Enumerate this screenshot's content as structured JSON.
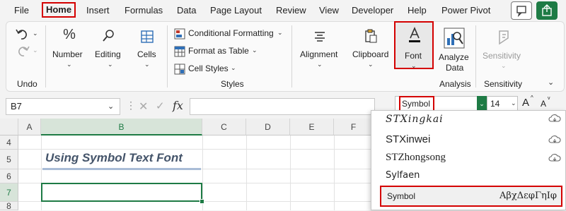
{
  "menu": {
    "tabs": [
      "File",
      "Home",
      "Insert",
      "Formulas",
      "Data",
      "Page Layout",
      "Review",
      "View",
      "Developer",
      "Help",
      "Power Pivot"
    ],
    "active": "Home"
  },
  "ribbon": {
    "undo_label": "Undo",
    "number_label": "Number",
    "editing_label": "Editing",
    "cells_label": "Cells",
    "cond_format": "Conditional Formatting",
    "format_table": "Format as Table",
    "cell_styles": "Cell Styles",
    "styles_label": "Styles",
    "alignment_label": "Alignment",
    "clipboard_label": "Clipboard",
    "font_label": "Font",
    "analyze_label_1": "Analyze",
    "analyze_label_2": "Data",
    "analysis_label": "Analysis",
    "sensitivity_btn": "Sensitivity",
    "sensitivity_label": "Sensitivity"
  },
  "formula_bar": {
    "name_box": "B7",
    "fx": "fx",
    "font_name": "Symbol",
    "font_size": "14",
    "grow_glyph": "A",
    "shrink_glyph": "A"
  },
  "grid": {
    "columns": [
      "A",
      "B",
      "C",
      "D",
      "E",
      "F"
    ],
    "rows": [
      "4",
      "5",
      "6",
      "7",
      "8"
    ],
    "cell_b5": "Using Symbol Text Font"
  },
  "font_list": {
    "items": [
      "STXingkai",
      "STXinwei",
      "STZhongsong",
      "Sylfaen",
      "Symbol"
    ],
    "symbol_preview": "ΑβχΔεφΓηΙφ"
  },
  "colors": {
    "accent_red": "#d40000",
    "excel_green": "#1e7b45",
    "title_blue": "#44546a"
  }
}
